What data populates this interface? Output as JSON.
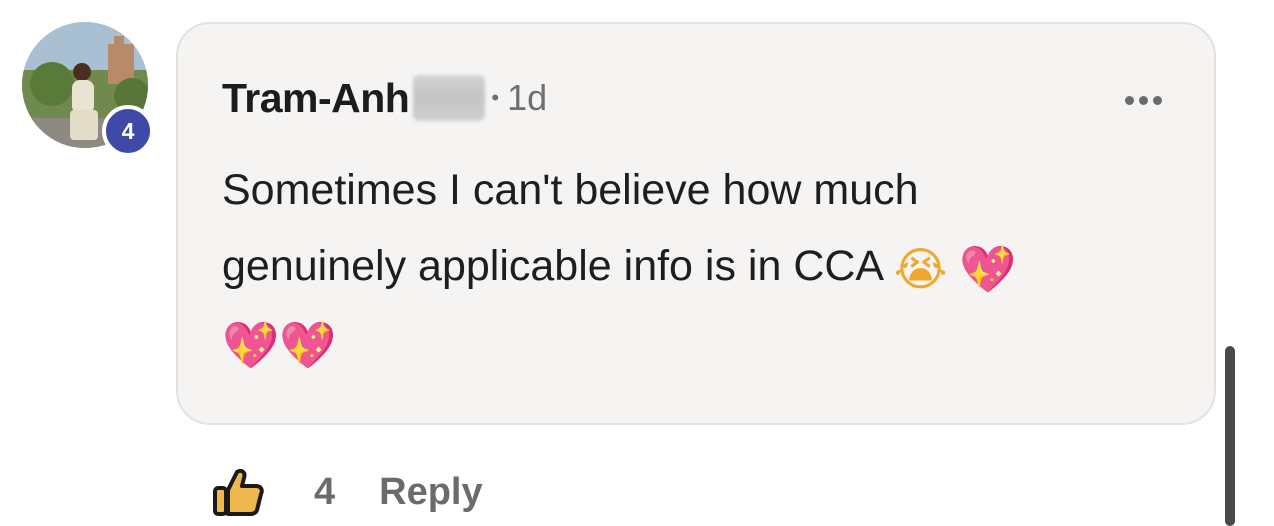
{
  "comment": {
    "author": "Tram-Anh",
    "separator": "•",
    "time": "1d",
    "text_line1": "Sometimes I can't believe how much",
    "text_line2": "genuinely applicable info is in CCA",
    "emojis": {
      "sob": "😭",
      "heart": "💖"
    },
    "avatar_level": "4"
  },
  "actions": {
    "like_count": "4",
    "reply_label": "Reply"
  },
  "icons": [
    "avatar-photo",
    "more-options-icon",
    "thumbs-up-icon"
  ],
  "colors": {
    "bubble_bg": "#f5f4f3",
    "badge_bg": "#3f4aa8",
    "like_icon_fill": "#f0b84c"
  }
}
